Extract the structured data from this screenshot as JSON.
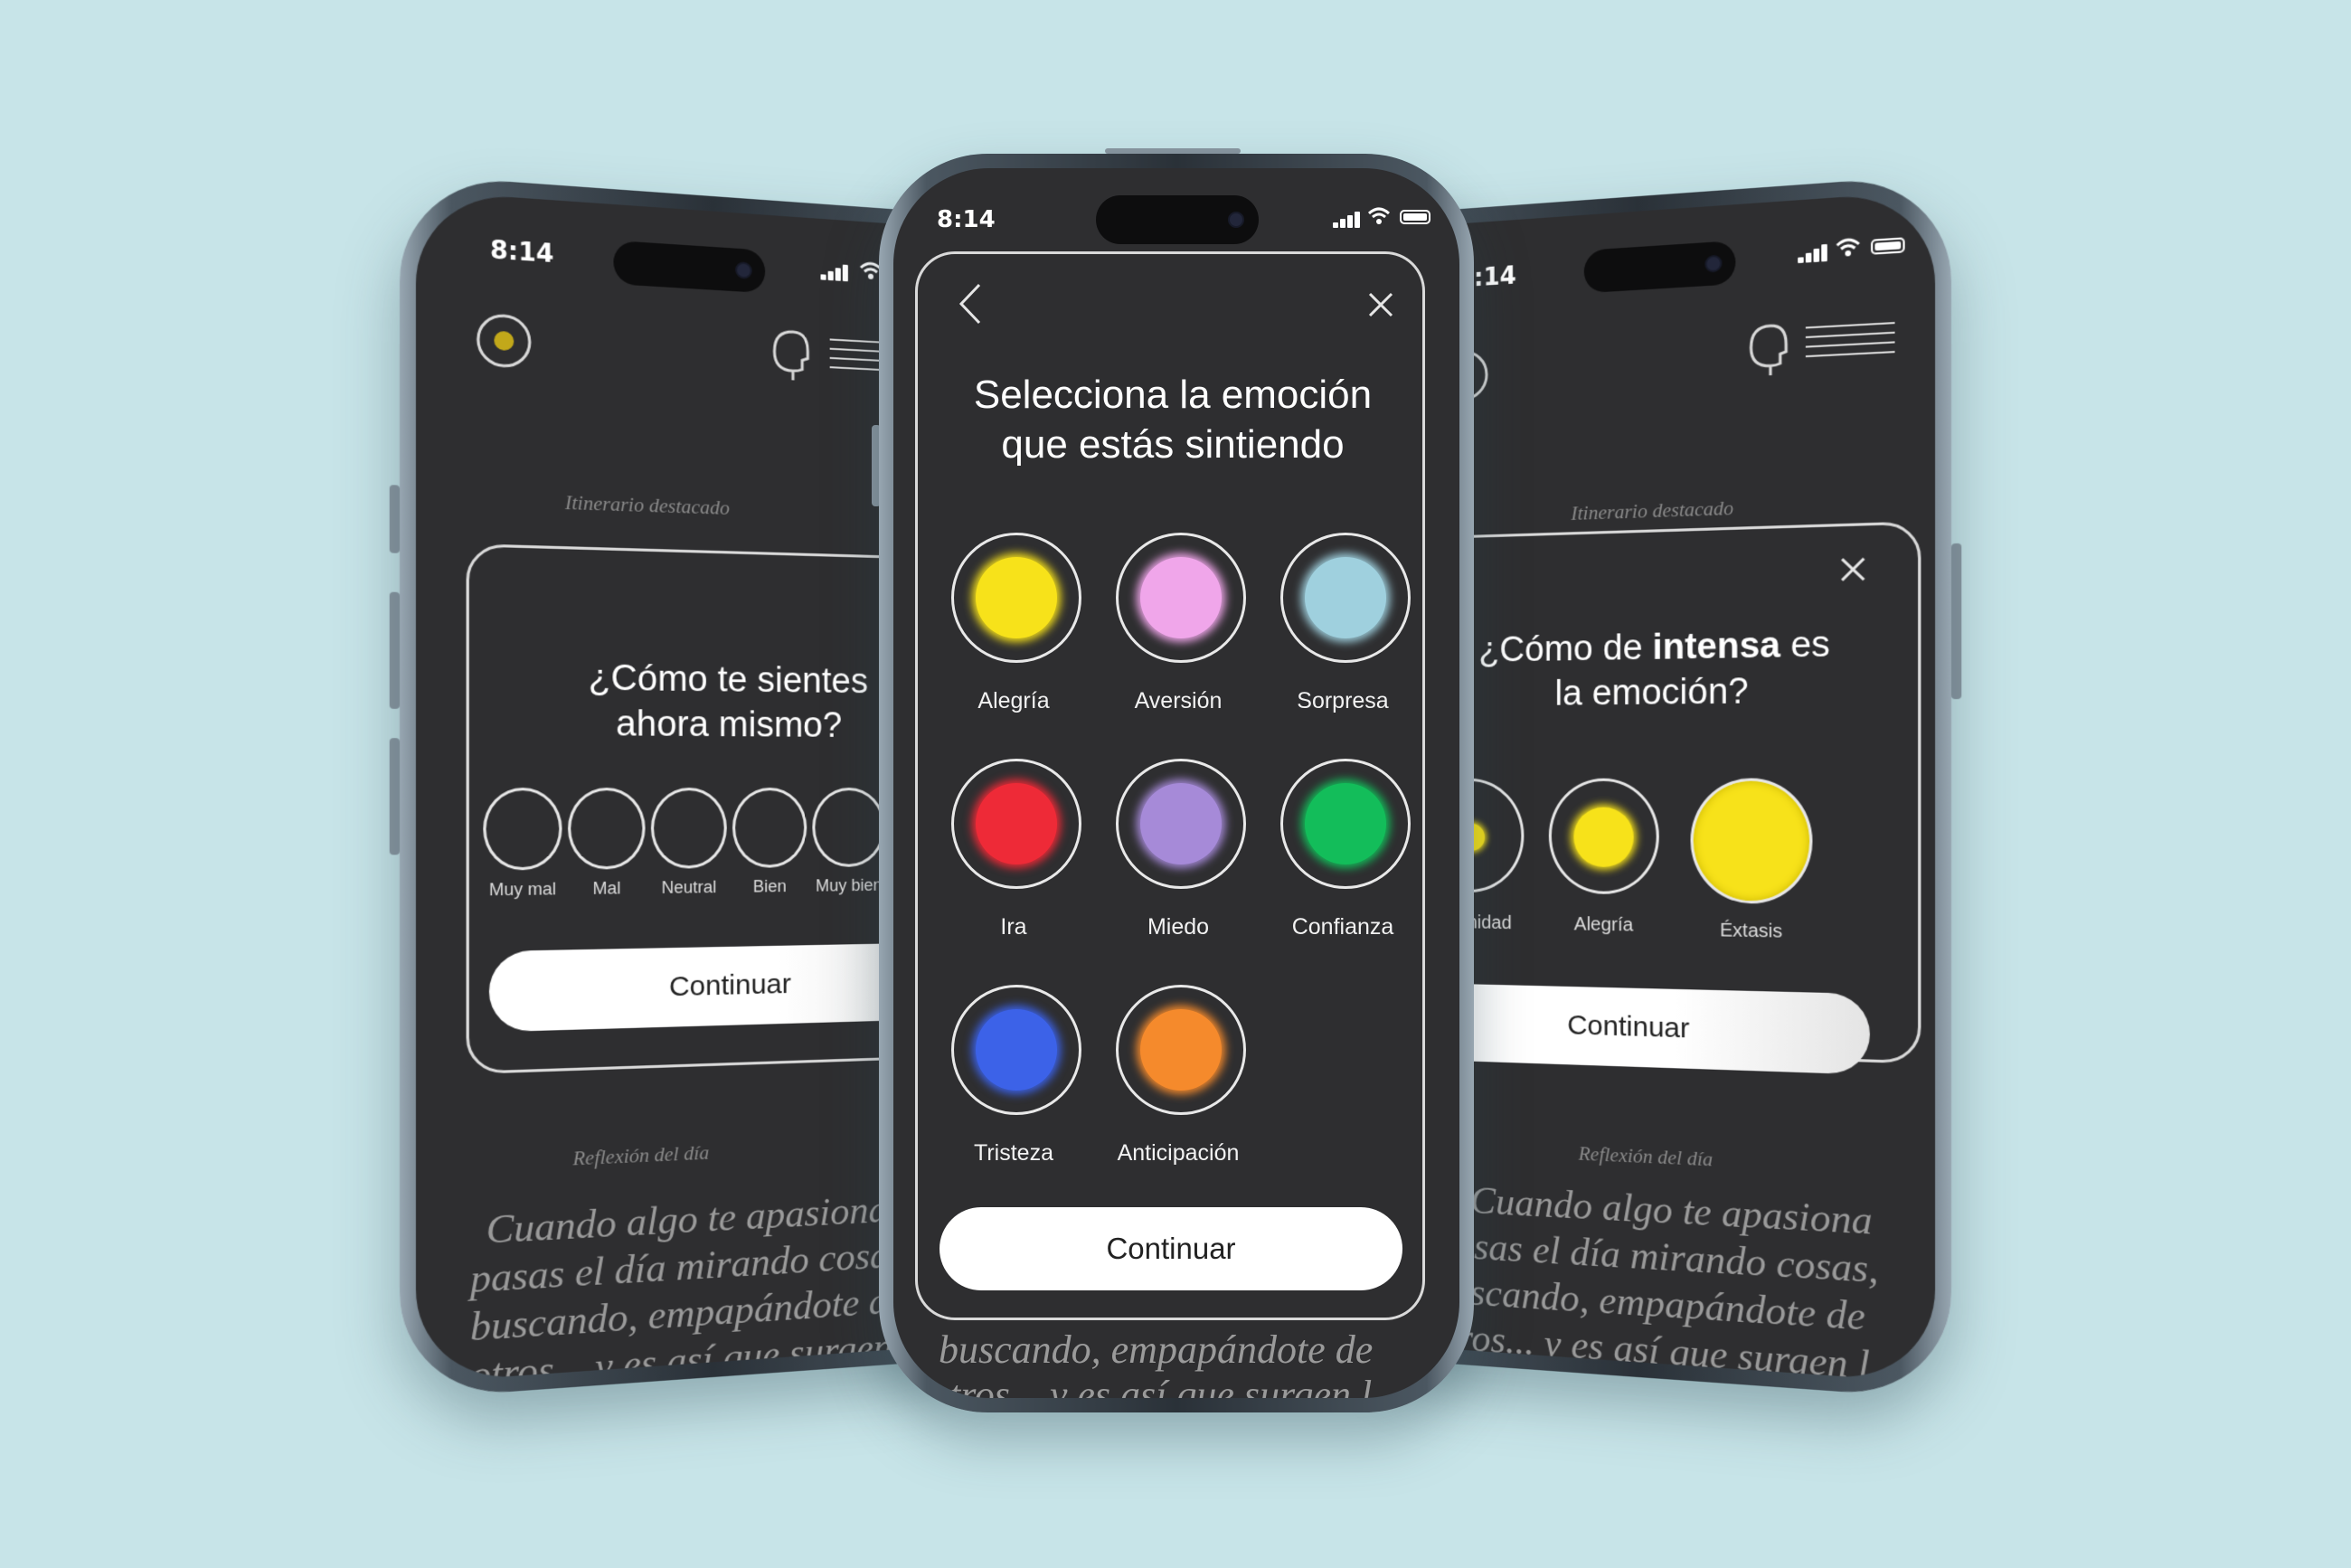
{
  "status": {
    "time": "8:14"
  },
  "left_phone": {
    "featured_label": "Itinerario destacado",
    "question": [
      "¿Cómo te sientes",
      "ahora mismo?"
    ],
    "moods": [
      "Muy mal",
      "Mal",
      "Neutral",
      "Bien",
      "Muy bien"
    ],
    "continue": "Continuar",
    "reflection_label": "Reflexión del día",
    "quote_lines": [
      "Cuando algo te apasiona",
      "pasas el día mirando cosas,",
      "buscando, empapándote de",
      "otros... y es así que surgen l"
    ]
  },
  "center_phone": {
    "title": [
      "Selecciona la emoción",
      "que estás sintiendo"
    ],
    "emotions": [
      {
        "label": "Alegría",
        "color": "#f7e21a"
      },
      {
        "label": "Aversión",
        "color": "#f0a6ea"
      },
      {
        "label": "Sorpresa",
        "color": "#9fd0de"
      },
      {
        "label": "Ira",
        "color": "#ee2a37"
      },
      {
        "label": "Miedo",
        "color": "#a68ad8"
      },
      {
        "label": "Confianza",
        "color": "#13bd5a"
      },
      {
        "label": "Tristeza",
        "color": "#3c62e8"
      },
      {
        "label": "Anticipación",
        "color": "#f58a2c"
      }
    ],
    "continue": "Continuar",
    "quote_lines": [
      "buscando, empapándote de",
      "otros... y es así que surgen l"
    ]
  },
  "right_phone": {
    "featured_label": "Itinerario destacado",
    "question_prefix": "¿Cómo de ",
    "question_bold": "intensa",
    "question_suffix": " es",
    "question_line2": "la emoción?",
    "intensities": [
      {
        "label": "Serenidad",
        "color": "#f7e21a"
      },
      {
        "label": "Alegría",
        "color": "#f7e21a"
      },
      {
        "label": "Éxtasis",
        "color": "#f7e21a"
      }
    ],
    "continue": "Continuar",
    "reflection_label": "Reflexión del día",
    "quote_lines": [
      "Cuando algo te apasiona",
      "pasas el día mirando cosas,",
      "buscando, empapándote de",
      "otros... y es así que surgen l"
    ]
  }
}
